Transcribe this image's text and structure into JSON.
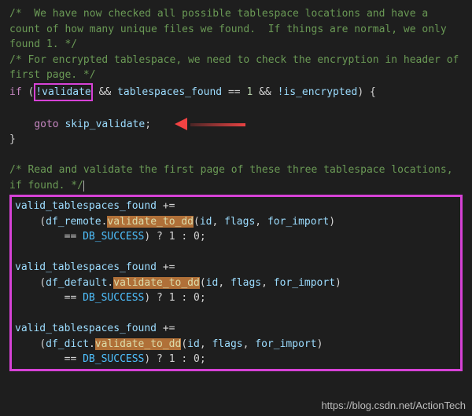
{
  "comments": {
    "c1": "/*  We have now checked all possible tablespace locations and have a count of how many unique files we found.  If things are normal, we only found 1. */",
    "c2": "/* For encrypted tablespace, we need to check the encryption in header of first page. */",
    "c3": "/* Read and validate the first page of these three tablespace locations, if found. */"
  },
  "code": {
    "if_kw": "if",
    "not_validate": "!validate",
    "and1": "&&",
    "tablespaces_found": "tablespaces_found",
    "eq": "==",
    "one": "1",
    "and2": "&&",
    "not_encrypted": "!is_encrypted",
    "lbrace": "{",
    "goto_kw": "goto",
    "skip_label": "skip_validate",
    "semi": ";",
    "rbrace": "}",
    "var_valid_ts": "valid_tablespaces_found",
    "plus_eq": "+=",
    "df_remote": "df_remote",
    "df_default": "df_default",
    "df_dict": "df_dict",
    "method": "validate_to_dd",
    "args_open": "(",
    "arg_id": "id",
    "arg_flags": "flags",
    "arg_for_import": "for_import",
    "args_close": ")",
    "db_success": "DB_SUCCESS",
    "ternary": "? 1 : 0;",
    "dot": ".",
    "comma": ", "
  },
  "watermark": "https://blog.csdn.net/ActionTech"
}
